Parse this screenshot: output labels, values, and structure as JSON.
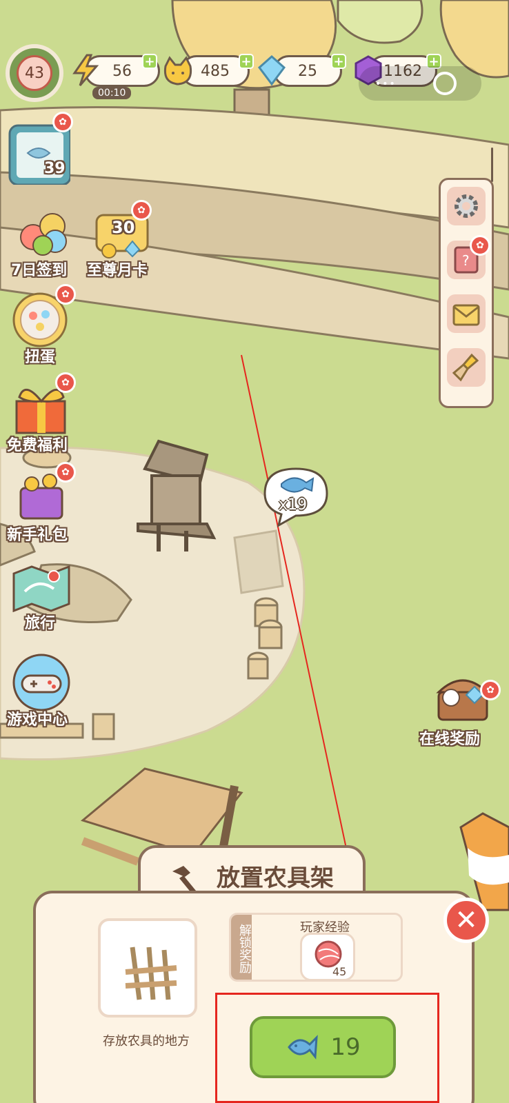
{
  "hud": {
    "level": "43",
    "energy": {
      "value": "56",
      "timer": "00:10"
    },
    "cat_coins": "485",
    "diamonds": "25",
    "gems": "1162",
    "plus_label": "+"
  },
  "left_menu": {
    "task_badge": "39",
    "items": [
      {
        "label": "7日签到"
      },
      {
        "label": "至尊月卡"
      },
      {
        "label": "扭蛋"
      },
      {
        "label": "免费福利"
      },
      {
        "label": "新手礼包"
      },
      {
        "label": "旅行"
      },
      {
        "label": "游戏中心"
      }
    ],
    "month_card_number": "30"
  },
  "right_menu": {
    "items": [
      "settings-icon",
      "help-book-icon",
      "mail-icon",
      "broom-icon"
    ]
  },
  "online_reward": {
    "label": "在线奖励"
  },
  "fish_bubble": {
    "count": "x19"
  },
  "place_panel": {
    "title": "放置农具架",
    "item_desc": "存放农具的地方",
    "unlock_label": "解锁奖励",
    "reward_title": "玩家经验",
    "reward_amount": "45",
    "cost": "19",
    "close_label": "✕"
  },
  "colors": {
    "accent_green": "#9fd356",
    "panel_bg": "#fdf3e4",
    "border_brown": "#8a6e5a",
    "highlight_red": "#e5261e"
  }
}
